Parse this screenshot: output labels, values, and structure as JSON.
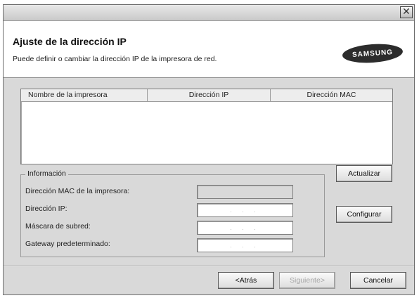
{
  "window": {
    "close_glyph": "✕"
  },
  "header": {
    "title": "Ajuste de la dirección IP",
    "subtitle": "Puede definir o cambiar la dirección IP de la impresora de red.",
    "logo_text": "SAMSUNG"
  },
  "printer_list": {
    "columns": [
      "Nombre de la impresora",
      "Dirección IP",
      "Dirección MAC"
    ],
    "rows": []
  },
  "info_group": {
    "label": "Información",
    "fields": [
      {
        "label": "Dirección MAC de la impresora:",
        "value": "",
        "enabled": false
      },
      {
        "label": "Dirección IP:",
        "value": ". . .",
        "enabled": true
      },
      {
        "label": "Máscara de subred:",
        "value": ". . .",
        "enabled": true
      },
      {
        "label": "Gateway predeterminado:",
        "value": ". . .",
        "enabled": true
      }
    ]
  },
  "buttons": {
    "update": "Actualizar",
    "configure": "Configurar",
    "back": "<Atrás",
    "next": "Siguiente>",
    "cancel": "Cancelar"
  },
  "icons": {
    "close": "close-icon"
  },
  "colors": {
    "background": "#d9d9d9",
    "header_background": "#ffffff",
    "logo": "#2c2c2c"
  }
}
